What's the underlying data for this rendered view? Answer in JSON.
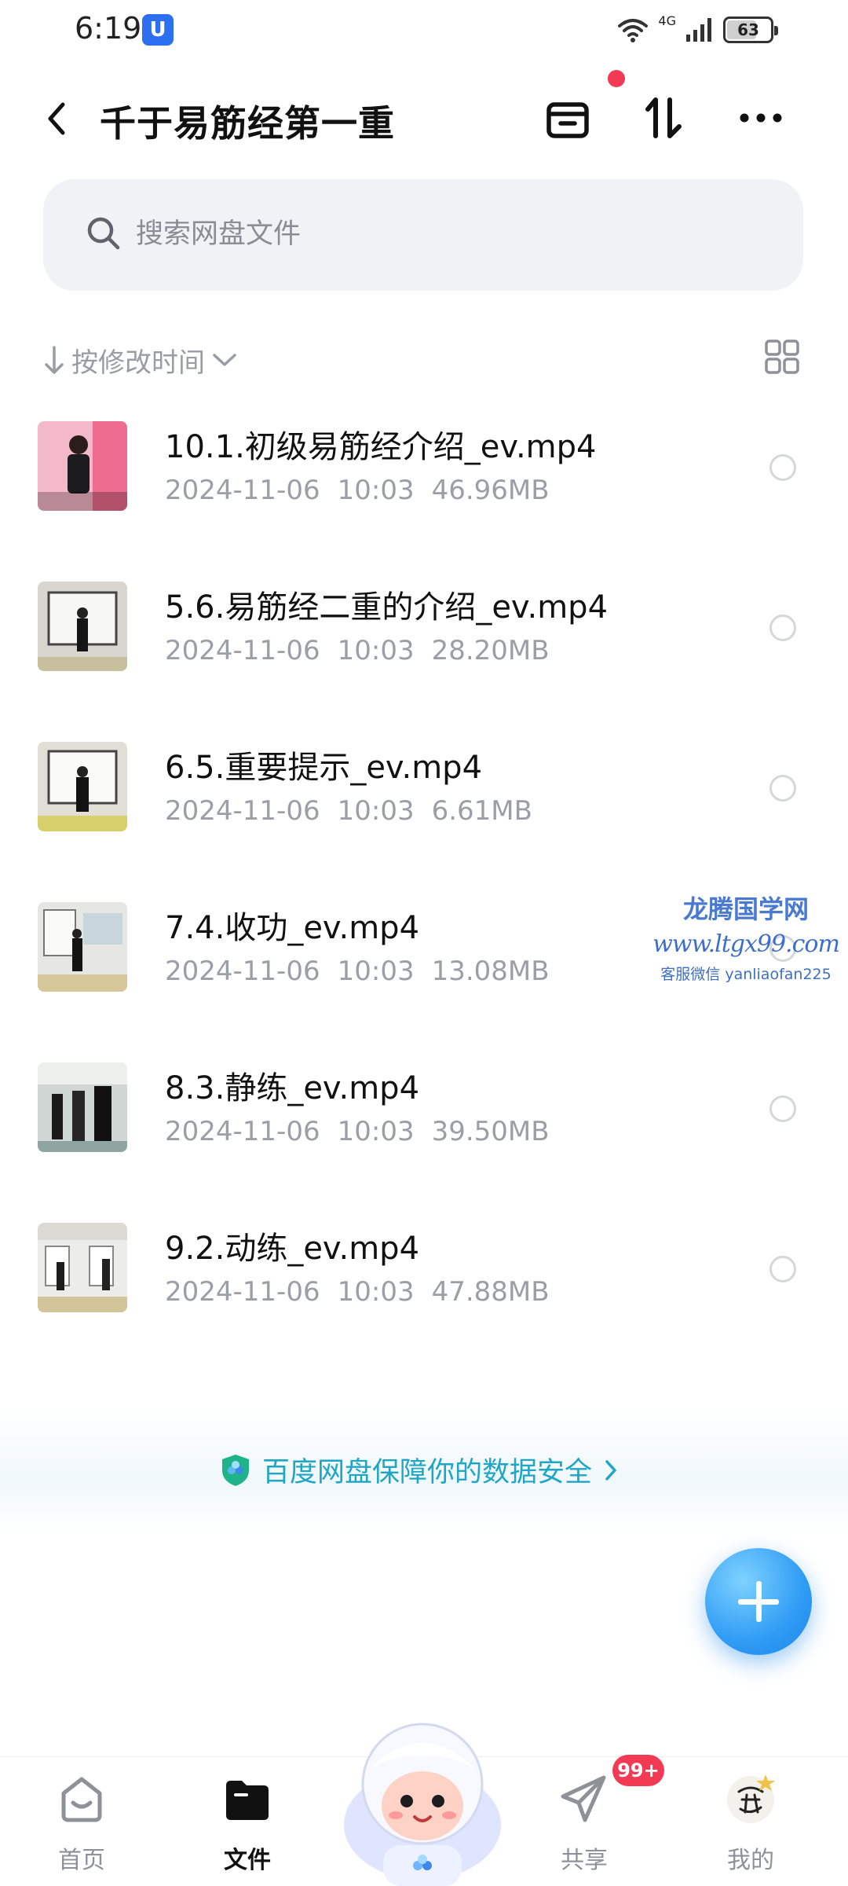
{
  "status_bar": {
    "time": "6:19",
    "app_badge": "U",
    "network": "4G",
    "battery": "63",
    "battery_level": 0.63
  },
  "header": {
    "title": "千于易筋经第一重"
  },
  "search": {
    "placeholder": "搜索网盘文件"
  },
  "sort": {
    "label": "按修改时间"
  },
  "files": [
    {
      "name": "10.1.初级易筋经介绍_ev.mp4",
      "date": "2024-11-06",
      "time": "10:03",
      "size": "46.96MB",
      "thumb": "pink"
    },
    {
      "name": "5.6.易筋经二重的介绍_ev.mp4",
      "date": "2024-11-06",
      "time": "10:03",
      "size": "28.20MB",
      "thumb": "board"
    },
    {
      "name": "6.5.重要提示_ev.mp4",
      "date": "2024-11-06",
      "time": "10:03",
      "size": "6.61MB",
      "thumb": "board"
    },
    {
      "name": "7.4.收功_ev.mp4",
      "date": "2024-11-06",
      "time": "10:03",
      "size": "13.08MB",
      "thumb": "room"
    },
    {
      "name": "8.3.静练_ev.mp4",
      "date": "2024-11-06",
      "time": "10:03",
      "size": "39.50MB",
      "thumb": "group"
    },
    {
      "name": "9.2.动练_ev.mp4",
      "date": "2024-11-06",
      "time": "10:03",
      "size": "47.88MB",
      "thumb": "room"
    }
  ],
  "watermark": {
    "title": "龙腾国学网",
    "url": "www.ltgx99.com",
    "contact": "客服微信 yanliaofan225"
  },
  "security": {
    "text": "百度网盘保障你的数据安全"
  },
  "nav": {
    "home": "首页",
    "files": "文件",
    "share": "共享",
    "mine": "我的",
    "share_badge": "99+"
  },
  "colors": {
    "accent": "#1fa6c6",
    "fab": "#2f9cf5",
    "badge": "#f23a55"
  }
}
